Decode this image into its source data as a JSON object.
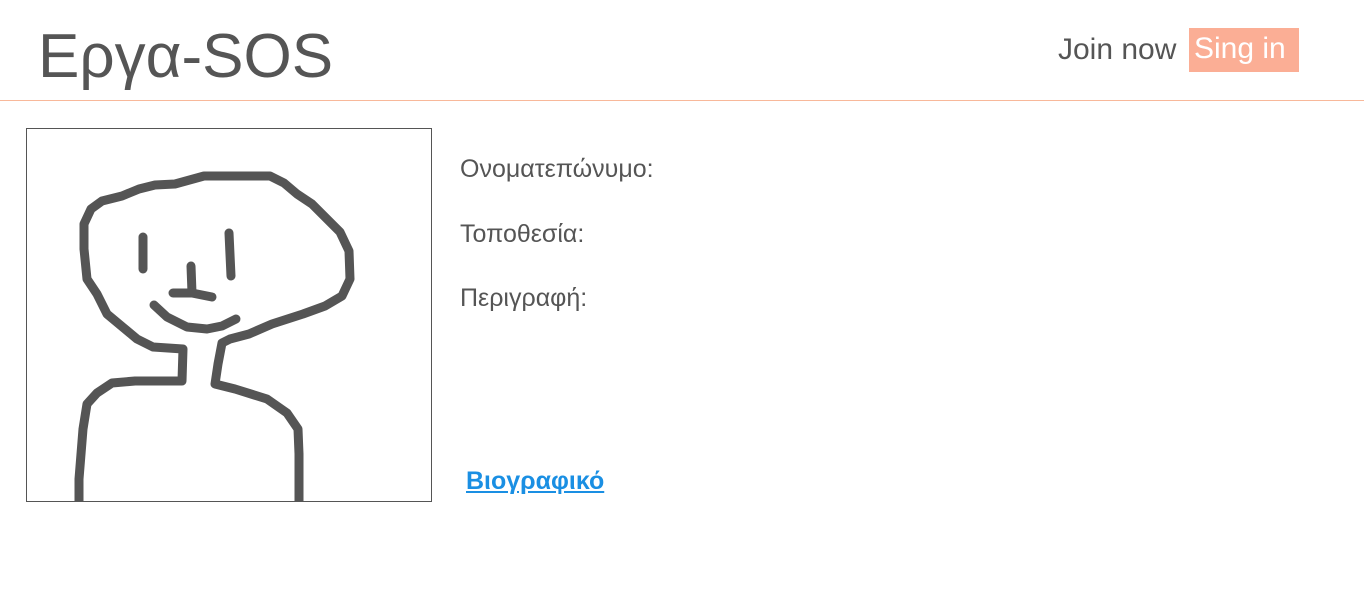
{
  "header": {
    "brand": "Εργα-SOS",
    "join_label": "Join now",
    "signin_label": "Sing in",
    "accent_color": "#fbae95",
    "divider_color": "#f8b89a"
  },
  "profile": {
    "fields": {
      "fullname_label": "Ονοματεπώνυμο:",
      "location_label": "Τοποθεσία:",
      "description_label": "Περιγραφή:"
    },
    "cv_link": "Βιογραφικό",
    "link_color": "#1a8fe3"
  }
}
